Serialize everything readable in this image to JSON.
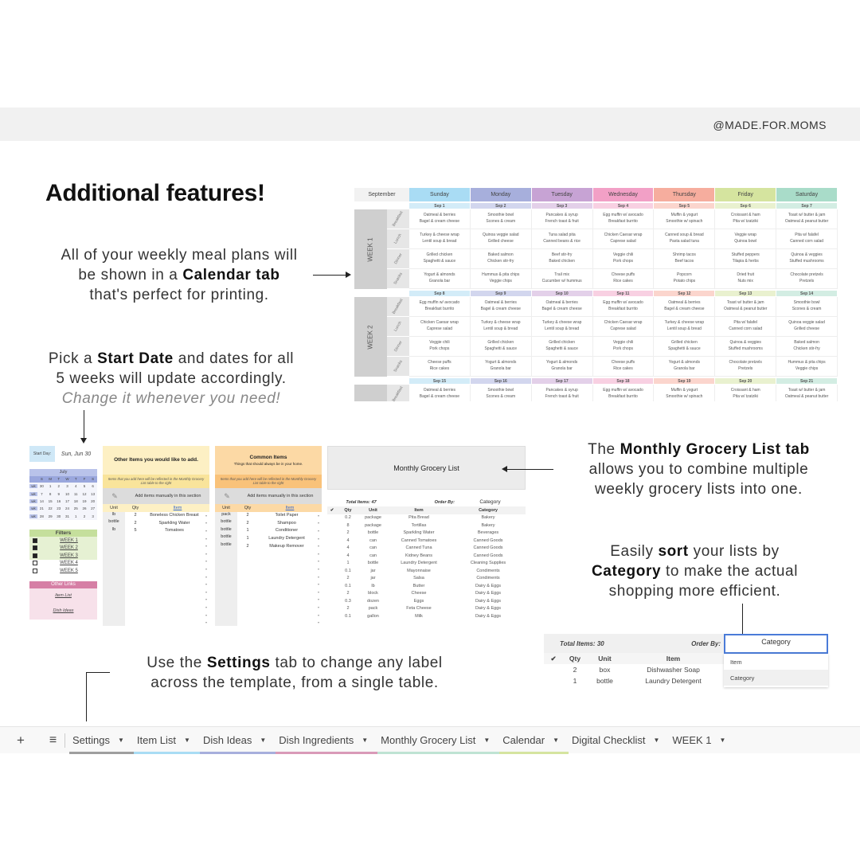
{
  "brand": "@MADE.FOR.MOMS",
  "title": "Additional features!",
  "blurbs": {
    "calendar": [
      "All of your weekly meal plans will",
      "be shown in a ",
      "Calendar tab",
      "that's perfect for printing."
    ],
    "startdate": [
      "Pick a ",
      "Start Date",
      " and dates for all",
      "5 weeks will update accordingly.",
      "Change it whenever you need!"
    ],
    "grocery": [
      "The ",
      "Monthly Grocery List tab",
      "allows you to combine multiple",
      "weekly grocery lists into one."
    ],
    "sort": [
      "Easily ",
      "sort",
      " your lists by",
      "Category",
      " to make the actual",
      "shopping more efficient."
    ],
    "settings": [
      "Use the ",
      "Settings",
      " tab to change any label",
      "across the template, from a single table."
    ]
  },
  "calendar": {
    "month": "September",
    "days": [
      "Sunday",
      "Monday",
      "Tuesday",
      "Wednesday",
      "Thursday",
      "Friday",
      "Saturday"
    ],
    "day_colors": [
      "#a9dcf4",
      "#a7afdc",
      "#c7a3d4",
      "#f2a0c6",
      "#f6ad9e",
      "#d5e49f",
      "#a9dcc9"
    ],
    "date_colors": [
      "#d3ecf8",
      "#d2d6ee",
      "#e3d0e9",
      "#f8d0e2",
      "#fbd5cd",
      "#e9f1cf",
      "#d3ede3"
    ],
    "meals": [
      "Breakfast",
      "Lunch",
      "Dinner",
      "Snacks"
    ],
    "weeks": [
      {
        "label": "WEEK 1",
        "dates": [
          "Sep 1",
          "Sep 2",
          "Sep 3",
          "Sep 4",
          "Sep 5",
          "Sep 6",
          "Sep 7"
        ],
        "rows": [
          [
            [
              "Oatmeal & berries",
              "Bagel & cream cheese"
            ],
            [
              "Smoothie bowl",
              "Scones & cream"
            ],
            [
              "Pancakes & syrup",
              "French toast & fruit"
            ],
            [
              "Egg muffin w/ avocado",
              "Breakfast burrito"
            ],
            [
              "Muffin & yogurt",
              "Smoothie w/ spinach"
            ],
            [
              "Croissant & ham",
              "Pita w/ tzatziki"
            ],
            [
              "Toast w/ butter & jam",
              "Oatmeal & peanut butter"
            ]
          ],
          [
            [
              "Turkey & cheese wrap",
              "Lentil soup & bread"
            ],
            [
              "Quinoa veggie salad",
              "Grilled cheese"
            ],
            [
              "Tuna salad pita",
              "Canned beans & rice"
            ],
            [
              "Chicken Caesar wrap",
              "Caprese salad"
            ],
            [
              "Canned soup & bread",
              "Pasta salad tuna"
            ],
            [
              "Veggie wrap",
              "Quinoa bowl"
            ],
            [
              "Pita w/ falafel",
              "Canned corn salad"
            ]
          ],
          [
            [
              "Grilled chicken",
              "Spaghetti & sauce"
            ],
            [
              "Baked salmon",
              "Chicken stir-fry"
            ],
            [
              "Beef stir-fry",
              "Baked chicken"
            ],
            [
              "Veggie chili",
              "Pork chops"
            ],
            [
              "Shrimp tacos",
              "Beef tacos"
            ],
            [
              "Stuffed peppers",
              "Tilapia & herbs"
            ],
            [
              "Quinoa & veggies",
              "Stuffed mushrooms"
            ]
          ],
          [
            [
              "Yogurt & almonds",
              "Granola bar"
            ],
            [
              "Hummus & pita chips",
              "Veggie chips"
            ],
            [
              "Trail mix",
              "Cucumber w/ hummus"
            ],
            [
              "Cheese puffs",
              "Rice cakes"
            ],
            [
              "Popcorn",
              "Potato chips"
            ],
            [
              "Dried fruit",
              "Nuts mix"
            ],
            [
              "Chocolate pretzels",
              "Pretzels"
            ]
          ]
        ]
      },
      {
        "label": "WEEK 2",
        "dates": [
          "Sep 8",
          "Sep 9",
          "Sep 10",
          "Sep 11",
          "Sep 12",
          "Sep 13",
          "Sep 14"
        ],
        "rows": [
          [
            [
              "Egg muffin w/ avocado",
              "Breakfast burrito"
            ],
            [
              "Oatmeal & berries",
              "Bagel & cream cheese"
            ],
            [
              "Oatmeal & berries",
              "Bagel & cream cheese"
            ],
            [
              "Egg muffin w/ avocado",
              "Breakfast burrito"
            ],
            [
              "Oatmeal & berries",
              "Bagel & cream cheese"
            ],
            [
              "Toast w/ butter & jam",
              "Oatmeal & peanut butter"
            ],
            [
              "Smoothie bowl",
              "Scones & cream"
            ]
          ],
          [
            [
              "Chicken Caesar wrap",
              "Caprese salad"
            ],
            [
              "Turkey & cheese wrap",
              "Lentil soup & bread"
            ],
            [
              "Turkey & cheese wrap",
              "Lentil soup & bread"
            ],
            [
              "Chicken Caesar wrap",
              "Caprese salad"
            ],
            [
              "Turkey & cheese wrap",
              "Lentil soup & bread"
            ],
            [
              "Pita w/ falafel",
              "Canned corn salad"
            ],
            [
              "Quinoa veggie salad",
              "Grilled cheese"
            ]
          ],
          [
            [
              "Veggie chili",
              "Pork chops"
            ],
            [
              "Grilled chicken",
              "Spaghetti & sauce"
            ],
            [
              "Grilled chicken",
              "Spaghetti & sauce"
            ],
            [
              "Veggie chili",
              "Pork chops"
            ],
            [
              "Grilled chicken",
              "Spaghetti & sauce"
            ],
            [
              "Quinoa & veggies",
              "Stuffed mushrooms"
            ],
            [
              "Baked salmon",
              "Chicken stir-fry"
            ]
          ],
          [
            [
              "Cheese puffs",
              "Rice cakes"
            ],
            [
              "Yogurt & almonds",
              "Granola bar"
            ],
            [
              "Yogurt & almonds",
              "Granola bar"
            ],
            [
              "Cheese puffs",
              "Rice cakes"
            ],
            [
              "Yogurt & almonds",
              "Granola bar"
            ],
            [
              "Chocolate pretzels",
              "Pretzels"
            ],
            [
              "Hummus & pita chips",
              "Veggie chips"
            ]
          ]
        ]
      },
      {
        "label": "",
        "dates": [
          "Sep 15",
          "Sep 16",
          "Sep 17",
          "Sep 18",
          "Sep 19",
          "Sep 20",
          "Sep 21"
        ],
        "rows": [
          [
            [
              "Oatmeal & berries",
              "Bagel & cream cheese"
            ],
            [
              "Smoothie bowl",
              "Scones & cream"
            ],
            [
              "Pancakes & syrup",
              "French toast & fruit"
            ],
            [
              "Egg muffin w/ avocado",
              "Breakfast burrito"
            ],
            [
              "Muffin & yogurt",
              "Smoothie w/ spinach"
            ],
            [
              "Croissant & ham",
              "Pita w/ tzatziki"
            ],
            [
              "Toast w/ butter & jam",
              "Oatmeal & peanut butter"
            ]
          ]
        ]
      }
    ]
  },
  "settings": {
    "start_day_label": "Start Day:",
    "start_day_value": "Sun, Jun 30",
    "mini_month": "July",
    "mini_days": [
      "S",
      "M",
      "T",
      "W",
      "T",
      "F",
      "S"
    ],
    "mini_weeks": [
      [
        "wk",
        "30",
        "1",
        "2",
        "3",
        "4",
        "5",
        "6"
      ],
      [
        "wk",
        "7",
        "8",
        "9",
        "10",
        "11",
        "12",
        "13"
      ],
      [
        "wk",
        "14",
        "15",
        "16",
        "17",
        "18",
        "19",
        "20"
      ],
      [
        "wk",
        "21",
        "22",
        "23",
        "24",
        "25",
        "26",
        "27"
      ],
      [
        "wk",
        "28",
        "29",
        "30",
        "31",
        "1",
        "2",
        "3"
      ]
    ],
    "filters_title": "Filters",
    "filters": [
      {
        "label": "WEEK 1",
        "checked": true
      },
      {
        "label": "WEEK 2",
        "checked": true
      },
      {
        "label": "WEEK 3",
        "checked": true
      },
      {
        "label": "WEEK 4",
        "checked": false
      },
      {
        "label": "WEEK 5",
        "checked": false
      }
    ],
    "links_title": "Other Links",
    "links": [
      "Item List",
      "Dish Ideas"
    ]
  },
  "other_items": {
    "title": "Other Items you would like to add.",
    "subtitle": "",
    "note": "Items that you add here will be reflected in the Monthly Grocery List table to the right",
    "add_label": "Add items manually in this section",
    "headers": [
      "Unit",
      "Qty",
      "Item"
    ],
    "rows": [
      [
        "lb",
        "2",
        "Boneless Chicken Breast"
      ],
      [
        "bottle",
        "2",
        "Sparkling Water"
      ],
      [
        "lb",
        "5",
        "Tomatoes"
      ]
    ]
  },
  "common_items": {
    "title": "Common Items",
    "subtitle": "Things that should always be in your home.",
    "note": "Items that you add here will be reflected in the Monthly Grocery List table to the right",
    "add_label": "Add items manually in this section",
    "headers": [
      "Unit",
      "Qty",
      "Item"
    ],
    "rows": [
      [
        "pack",
        "2",
        "Toilet Paper"
      ],
      [
        "bottle",
        "2",
        "Shampoo"
      ],
      [
        "bottle",
        "1",
        "Conditioner"
      ],
      [
        "bottle",
        "1",
        "Laundry Detergent"
      ],
      [
        "bottle",
        "2",
        "Makeup Remover"
      ]
    ]
  },
  "monthly": {
    "title": "Monthly Grocery List",
    "total": "Total Items: 47",
    "order_label": "Order By:",
    "order_value": "Category",
    "headers": [
      "✔",
      "Qty",
      "Unit",
      "Item",
      "Category"
    ],
    "rows": [
      [
        "0.2",
        "package",
        "Pita Bread",
        "Bakery"
      ],
      [
        "8",
        "package",
        "Tortillas",
        "Bakery"
      ],
      [
        "2",
        "bottle",
        "Sparkling Water",
        "Beverages"
      ],
      [
        "4",
        "can",
        "Canned Tomatoes",
        "Canned Goods"
      ],
      [
        "4",
        "can",
        "Canned Tuna",
        "Canned Goods"
      ],
      [
        "4",
        "can",
        "Kidney Beans",
        "Canned Goods"
      ],
      [
        "1",
        "bottle",
        "Laundry Detergent",
        "Cleaning Supplies"
      ],
      [
        "0.1",
        "jar",
        "Mayonnaise",
        "Condiments"
      ],
      [
        "2",
        "jar",
        "Salsa",
        "Condiments"
      ],
      [
        "0.1",
        "lb",
        "Butter",
        "Dairy & Eggs"
      ],
      [
        "2",
        "block",
        "Cheese",
        "Dairy & Eggs"
      ],
      [
        "0.3",
        "dozen",
        "Eggs",
        "Dairy & Eggs"
      ],
      [
        "2",
        "pack",
        "Feta Cheese",
        "Dairy & Eggs"
      ],
      [
        "0.1",
        "gallon",
        "Milk",
        "Dairy & Eggs"
      ]
    ]
  },
  "sort_demo": {
    "total": "Total Items: 30",
    "order_label": "Order By:",
    "order_value": "Category",
    "headers": [
      "✔",
      "Qty",
      "Unit",
      "Item"
    ],
    "rows": [
      [
        "2",
        "box",
        "Dishwasher Soap"
      ],
      [
        "1",
        "bottle",
        "Laundry Detergent"
      ]
    ],
    "options": [
      "Item",
      "Category"
    ]
  },
  "tabs": [
    {
      "label": "Settings",
      "color": "#9e9e9e"
    },
    {
      "label": "Item List",
      "color": "#a9dcf4"
    },
    {
      "label": "Dish Ideas",
      "color": "#a7afdc"
    },
    {
      "label": "Dish Ingredients",
      "color": "#d99ab8"
    },
    {
      "label": "Monthly Grocery List",
      "color": "#bfe3d3"
    },
    {
      "label": "Calendar",
      "color": "#d5e49f"
    },
    {
      "label": "Digital Checklist",
      "color": ""
    },
    {
      "label": "WEEK 1",
      "color": ""
    }
  ],
  "tabbar_icons": [
    "plus-icon",
    "menu-icon"
  ]
}
